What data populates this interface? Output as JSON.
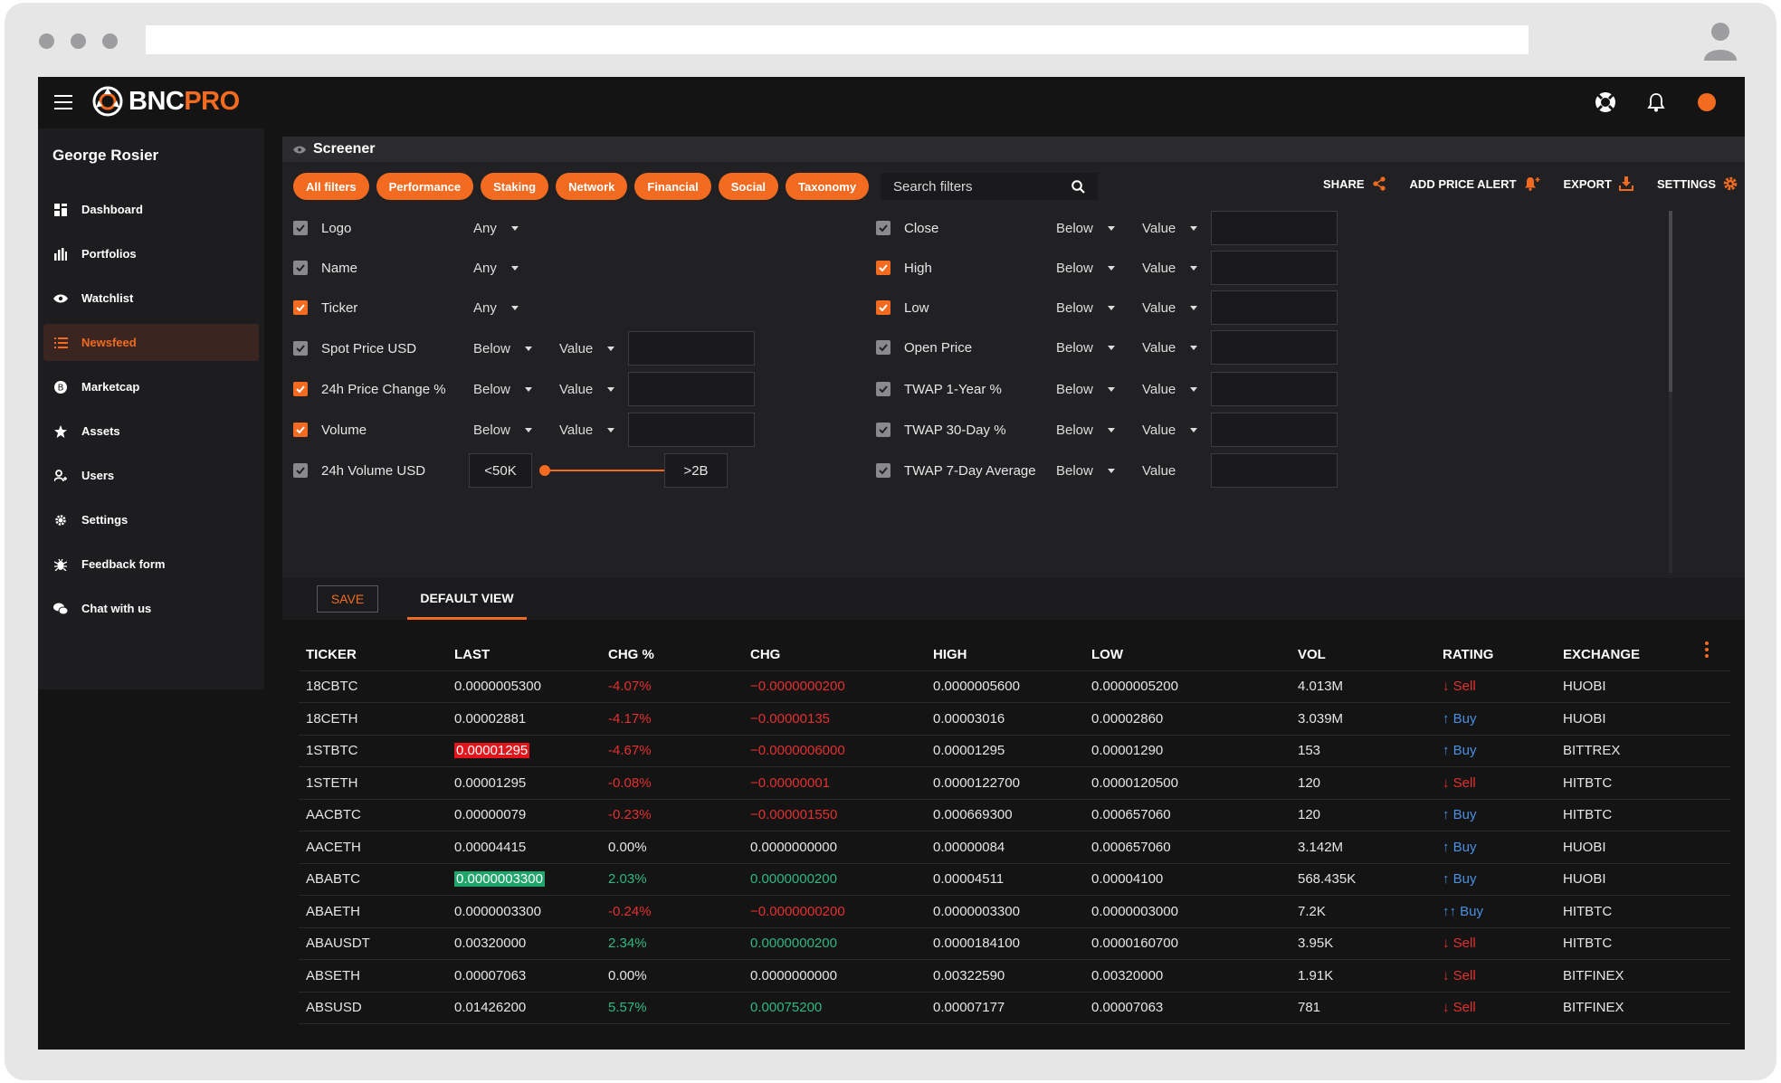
{
  "app": {
    "brand_primary": "BNC",
    "brand_accent": "PRO",
    "accent_color": "#f26b21"
  },
  "user": {
    "name": "George Rosier"
  },
  "sidebar": {
    "items": [
      {
        "label": "Dashboard",
        "icon": "dashboard-icon"
      },
      {
        "label": "Portfolios",
        "icon": "bar-chart-icon"
      },
      {
        "label": "Watchlist",
        "icon": "eye-icon"
      },
      {
        "label": "Newsfeed",
        "icon": "list-icon",
        "active": true
      },
      {
        "label": "Marketcap",
        "icon": "coin-icon"
      },
      {
        "label": "Assets",
        "icon": "star-icon"
      },
      {
        "label": "Users",
        "icon": "user-icon"
      },
      {
        "label": "Settings",
        "icon": "gear-icon"
      },
      {
        "label": "Feedback form",
        "icon": "bug-icon"
      },
      {
        "label": "Chat with us",
        "icon": "chat-icon"
      }
    ]
  },
  "screener": {
    "title": "Screener",
    "pills": [
      "All filters",
      "Performance",
      "Staking",
      "Network",
      "Financial",
      "Social",
      "Taxonomy"
    ],
    "search_placeholder": "Search filters",
    "actions": {
      "share": "SHARE",
      "alert": "ADD PRICE ALERT",
      "export": "EXPORT",
      "settings": "SETTINGS"
    },
    "left_filters": [
      {
        "label": "Logo",
        "checked": false,
        "op": "Any"
      },
      {
        "label": "Name",
        "checked": false,
        "op": "Any"
      },
      {
        "label": "Ticker",
        "checked": true,
        "op": "Any"
      },
      {
        "label": "Spot Price USD",
        "checked": false,
        "op": "Below",
        "mode": "Value"
      },
      {
        "label": "24h Price Change %",
        "checked": true,
        "op": "Below",
        "mode": "Value"
      },
      {
        "label": "Volume",
        "checked": true,
        "op": "Below",
        "mode": "Value"
      },
      {
        "label": "24h Volume USD",
        "checked": false,
        "range_min": "<50K",
        "range_max": ">2B"
      }
    ],
    "right_filters": [
      {
        "label": "Close",
        "checked": false,
        "op": "Below",
        "mode": "Value"
      },
      {
        "label": "High",
        "checked": true,
        "op": "Below",
        "mode": "Value"
      },
      {
        "label": "Low",
        "checked": true,
        "op": "Below",
        "mode": "Value"
      },
      {
        "label": "Open Price",
        "checked": false,
        "op": "Below",
        "mode": "Value"
      },
      {
        "label": "TWAP 1-Year %",
        "checked": false,
        "op": "Below",
        "mode": "Value"
      },
      {
        "label": "TWAP 30-Day %",
        "checked": false,
        "op": "Below",
        "mode": "Value"
      },
      {
        "label": "TWAP 7-Day Average",
        "checked": false,
        "op": "Below",
        "mode": "Value"
      }
    ]
  },
  "viewbar": {
    "save": "SAVE",
    "default_view": "DEFAULT VIEW"
  },
  "table": {
    "headers": [
      "TICKER",
      "LAST",
      "CHG %",
      "CHG",
      "HIGH",
      "LOW",
      "VOL",
      "RATING",
      "EXCHANGE"
    ],
    "rows": [
      {
        "ticker": "18CBTC",
        "last": "0.0000005300",
        "chg_pct": "-4.07%",
        "chg": "−0.0000000200",
        "high": "0.0000005600",
        "low": "0.0000005200",
        "vol": "4.013M",
        "rating": "↓ Sell",
        "exchange": "HUOBI",
        "dir": "neg",
        "rate": "sell"
      },
      {
        "ticker": "18CETH",
        "last": "0.00002881",
        "chg_pct": "-4.17%",
        "chg": "−0.00000135",
        "high": "0.00003016",
        "low": "0.00002860",
        "vol": "3.039M",
        "rating": "↑ Buy",
        "exchange": "HUOBI",
        "dir": "neg",
        "rate": "buy"
      },
      {
        "ticker": "1STBTC",
        "last": "0.00001295",
        "chg_pct": "-4.67%",
        "chg": "−0.0000006000",
        "high": "0.00001295",
        "low": "0.00001290",
        "vol": "153",
        "rating": "↑ Buy",
        "exchange": "BITTREX",
        "dir": "neg",
        "rate": "buy",
        "hl": "red"
      },
      {
        "ticker": "1STETH",
        "last": "0.00001295",
        "chg_pct": "-0.08%",
        "chg": "−0.00000001",
        "high": "0.0000122700",
        "low": "0.0000120500",
        "vol": "120",
        "rating": "↓ Sell",
        "exchange": "HITBTC",
        "dir": "neg",
        "rate": "sell"
      },
      {
        "ticker": "AACBTC",
        "last": "0.00000079",
        "chg_pct": "-0.23%",
        "chg": "−0.000001550",
        "high": "0.000669300",
        "low": "0.000657060",
        "vol": "120",
        "rating": "↑ Buy",
        "exchange": "HITBTC",
        "dir": "neg",
        "rate": "buy"
      },
      {
        "ticker": "AACETH",
        "last": "0.00004415",
        "chg_pct": "0.00%",
        "chg": "0.0000000000",
        "high": "0.00000084",
        "low": "0.000657060",
        "vol": "3.142M",
        "rating": "↑ Buy",
        "exchange": "HUOBI",
        "dir": "zero",
        "rate": "buy"
      },
      {
        "ticker": "ABABTC",
        "last": "0.0000003300",
        "chg_pct": "2.03%",
        "chg": "0.0000000200",
        "high": "0.00004511",
        "low": "0.00004100",
        "vol": "568.435K",
        "rating": "↑ Buy",
        "exchange": "HUOBI",
        "dir": "pos",
        "rate": "buy",
        "hl": "green"
      },
      {
        "ticker": "ABAETH",
        "last": "0.0000003300",
        "chg_pct": "-0.24%",
        "chg": "−0.0000000200",
        "high": "0.0000003300",
        "low": "0.0000003000",
        "vol": "7.2K",
        "rating": "↑↑ Buy",
        "exchange": "HITBTC",
        "dir": "neg",
        "rate": "buy"
      },
      {
        "ticker": "ABAUSDT",
        "last": "0.00320000",
        "chg_pct": "2.34%",
        "chg": "0.0000000200",
        "high": "0.0000184100",
        "low": "0.0000160700",
        "vol": "3.95K",
        "rating": "↓ Sell",
        "exchange": "HITBTC",
        "dir": "pos",
        "rate": "sell"
      },
      {
        "ticker": "ABSETH",
        "last": "0.00007063",
        "chg_pct": "0.00%",
        "chg": "0.0000000000",
        "high": "0.00322590",
        "low": "0.00320000",
        "vol": "1.91K",
        "rating": "↓ Sell",
        "exchange": "BITFINEX",
        "dir": "zero",
        "rate": "sell"
      },
      {
        "ticker": "ABSUSD",
        "last": "0.01426200",
        "chg_pct": "5.57%",
        "chg": "0.00075200",
        "high": "0.00007177",
        "low": "0.00007063",
        "vol": "781",
        "rating": "↓ Sell",
        "exchange": "BITFINEX",
        "dir": "pos",
        "rate": "sell"
      }
    ]
  }
}
